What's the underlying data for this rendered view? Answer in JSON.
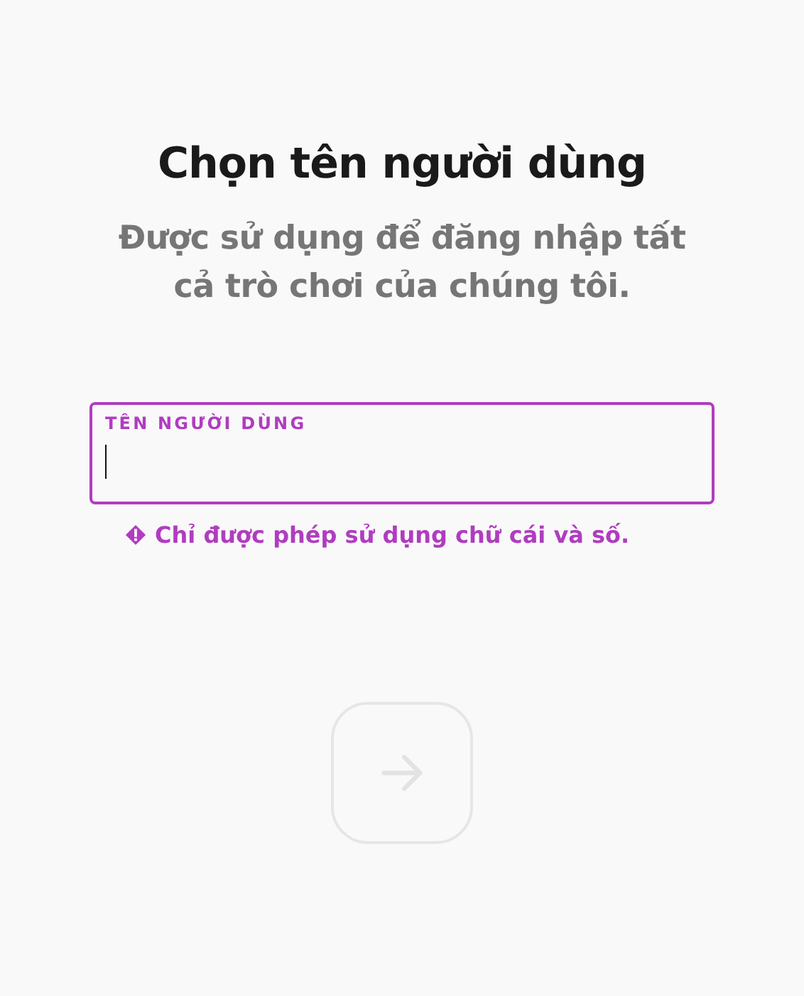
{
  "title": "Chọn tên người dùng",
  "subtitle": "Được sử dụng để đăng nhập tất cả trò chơi của chúng tôi.",
  "username_field": {
    "label": "TÊN NGƯỜI DÙNG",
    "focused": true,
    "invalid": true
  },
  "error": "Chỉ được phép sử dụng chữ cái và số.",
  "next_button": {
    "disabled": true
  }
}
